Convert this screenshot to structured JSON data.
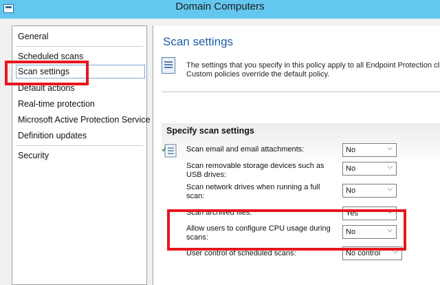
{
  "window": {
    "title": "Domain Computers"
  },
  "nav": {
    "items": [
      {
        "label": "General",
        "selected": false
      },
      {
        "label": "Scheduled scans",
        "selected": false
      },
      {
        "label": "Scan settings",
        "selected": true
      },
      {
        "label": "Default actions",
        "selected": false
      },
      {
        "label": "Real-time protection",
        "selected": false
      },
      {
        "label": "Microsoft Active Protection Service",
        "selected": false
      },
      {
        "label": "Definition updates",
        "selected": false
      },
      {
        "label": "Security",
        "selected": false
      }
    ]
  },
  "content": {
    "heading": "Scan settings",
    "description_line1": "The settings that you specify in this policy apply to all Endpoint Protection client",
    "description_line2": "Custom policies override the default policy.",
    "section_title": "Specify scan settings",
    "settings": [
      {
        "label_line1": "Scan email and email attachments:",
        "label_line2": "",
        "value": "No"
      },
      {
        "label_line1": "Scan removable storage devices such as",
        "label_line2": "USB drives:",
        "value": "No"
      },
      {
        "label_line1": "Scan network drives when running a full",
        "label_line2": "scan:",
        "value": "No"
      },
      {
        "label_line1": "Scan archived files:",
        "label_line2": "",
        "value": "Yes"
      },
      {
        "label_line1": "Allow users to configure CPU usage during",
        "label_line2": "scans:",
        "value": "No"
      },
      {
        "label_line1": "User control of scheduled scans:",
        "label_line2": "",
        "value": "No control"
      }
    ]
  },
  "colors": {
    "titlebar": "#64c7ef",
    "heading": "#1c5ea8",
    "highlight": "#e8141c"
  },
  "icons": {
    "app": "window-icon",
    "policy": "policy-document-icon",
    "settings": "scan-settings-icon",
    "dropdown": "chevron-down-icon"
  }
}
